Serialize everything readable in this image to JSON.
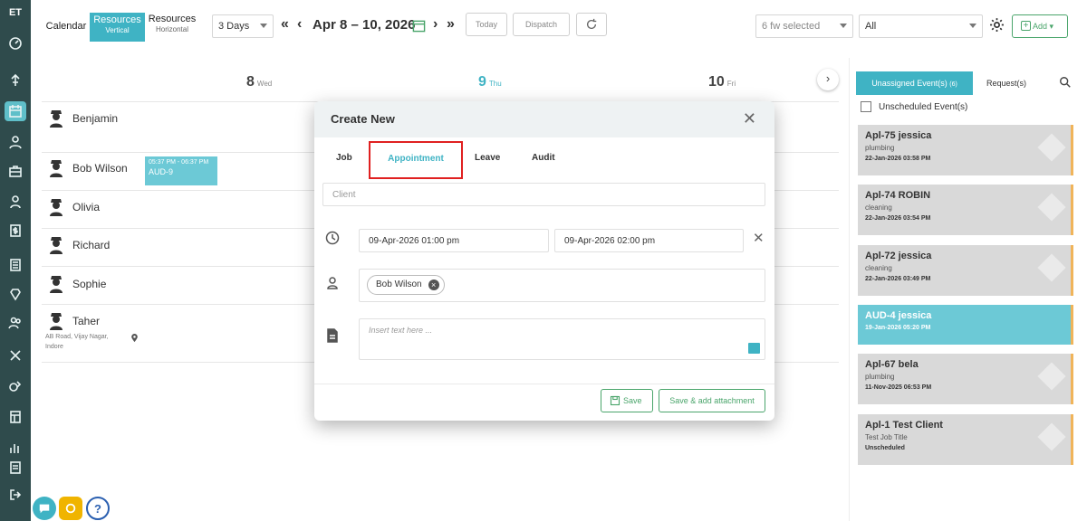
{
  "brand": {
    "logo": "ET"
  },
  "sidebar": {
    "icons": [
      "dashboard-icon",
      "location-icon",
      "calendar-icon",
      "team-icon",
      "toolbox-icon",
      "user-icon",
      "dollar-icon",
      "ledger-icon",
      "diamond-icon",
      "staff-icon",
      "tools-icon",
      "money-icon",
      "report-icon",
      "chart-icon",
      "document-icon",
      "logout-icon"
    ]
  },
  "toolbar": {
    "tab_calendar": "Calendar",
    "tab_resources_vertical": "Resources",
    "tab_resources_vertical_sub": "Vertical",
    "tab_resources_horizontal": "Resources",
    "tab_resources_horizontal_sub": "Horizontal",
    "view_select": "3 Days",
    "nav_prev_far": "«",
    "nav_prev": "‹",
    "date_range": "Apr 8 – 10, 2026",
    "nav_next": "›",
    "nav_next_far": "»",
    "today_label": "Today",
    "dispatch_label": "Dispatch",
    "fw_select": "6 fw selected",
    "filter_select": "All",
    "add_label": "Add ▾"
  },
  "calendar": {
    "days": [
      {
        "num": "8",
        "dow": "Wed"
      },
      {
        "num": "9",
        "dow": "Thu"
      },
      {
        "num": "10",
        "dow": "Fri"
      }
    ],
    "resources": [
      {
        "name": "Benjamin"
      },
      {
        "name": "Bob Wilson"
      },
      {
        "name": "Olivia"
      },
      {
        "name": "Richard"
      },
      {
        "name": "Sophie"
      },
      {
        "name": "Taher",
        "address_line1": "AB Road, Vijay Nagar,",
        "address_line2": "Indore"
      }
    ],
    "event": {
      "time": "05:37 PM - 06:37 PM",
      "label": "AUD-9"
    }
  },
  "modal": {
    "title": "Create New",
    "tabs": {
      "job": "Job",
      "appointment": "Appointment",
      "leave": "Leave",
      "audit": "Audit"
    },
    "client_placeholder": "Client",
    "start_datetime": "09-Apr-2026 01:00 pm",
    "end_datetime": "09-Apr-2026 02:00 pm",
    "assignee_chip": "Bob Wilson",
    "notes_placeholder": "Insert text here ...",
    "save_label": "Save",
    "save_attach_label": "Save & add attachment"
  },
  "right_panel": {
    "tab_unassigned": "Unassigned Event(s)",
    "tab_unassigned_count": "(6)",
    "tab_requests": "Request(s)",
    "unscheduled_label": "Unscheduled Event(s)",
    "cards": [
      {
        "title": "Apl-75 jessica",
        "sub": "plumbing",
        "date": "22-Jan-2026 03:58 PM",
        "highlight": false
      },
      {
        "title": "Apl-74 ROBIN",
        "sub": "cleaning",
        "date": "22-Jan-2026 03:54 PM",
        "highlight": false
      },
      {
        "title": "Apl-72 jessica",
        "sub": "cleaning",
        "date": "22-Jan-2026 03:49 PM",
        "highlight": false
      },
      {
        "title": "AUD-4 jessica",
        "sub": "",
        "date": "19-Jan-2026 05:20 PM",
        "highlight": true
      },
      {
        "title": "Apl-67 bela",
        "sub": "plumbing",
        "date": "11-Nov-2025 06:53 PM",
        "highlight": false
      },
      {
        "title": "Apl-1 Test Client",
        "sub": "Test Job Title",
        "date": "Unscheduled",
        "highlight": false
      }
    ]
  },
  "floating": {
    "help_label": "?"
  },
  "colors": {
    "sidebar": "#2f4b4c",
    "accent": "#3fb3c4",
    "green": "#4aa56b",
    "highlight_border": "#e02020"
  }
}
